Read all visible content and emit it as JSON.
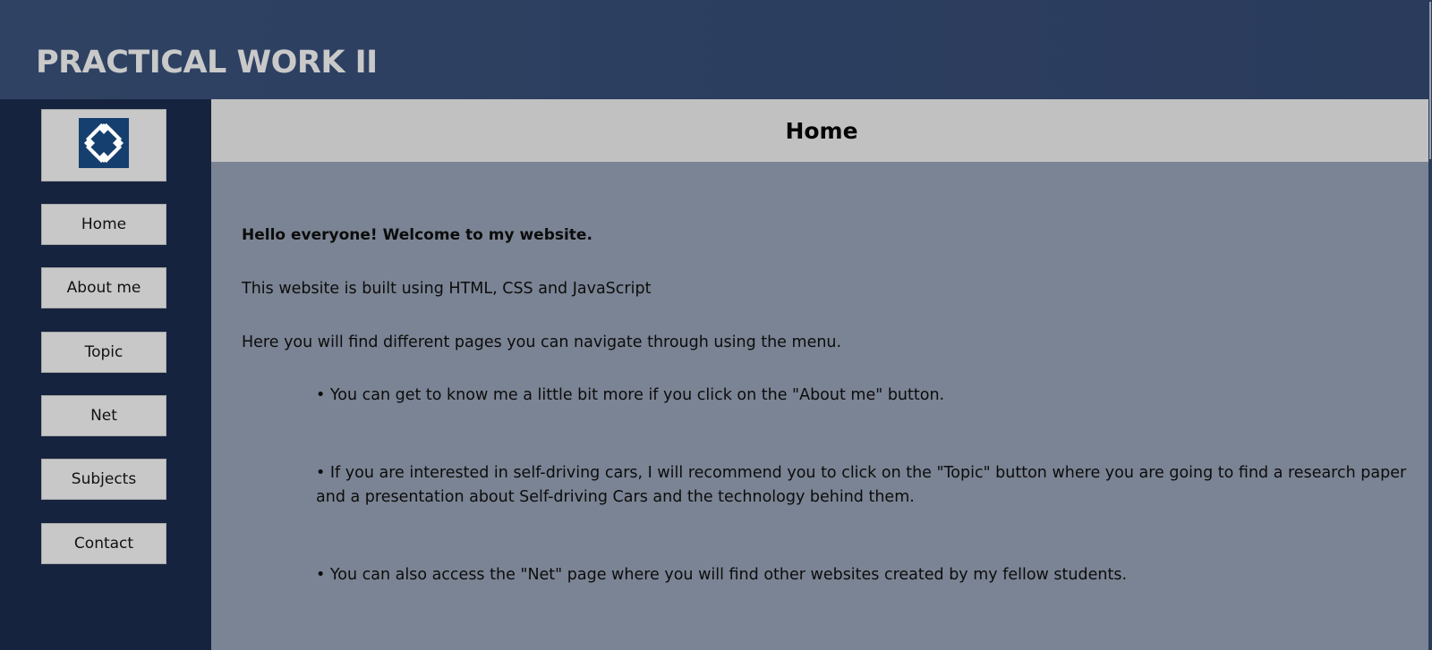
{
  "header": {
    "title": "PRACTICAL WORK II"
  },
  "sidebar": {
    "logo_icon": "logo-icon",
    "items": [
      {
        "label": "Home"
      },
      {
        "label": "About me"
      },
      {
        "label": "Topic"
      },
      {
        "label": "Net"
      },
      {
        "label": "Subjects"
      },
      {
        "label": "Contact"
      }
    ]
  },
  "main": {
    "page_title": "Home",
    "welcome": "Hello everyone! Welcome to my website.",
    "built_with": "This website is built using HTML, CSS and JavaScript",
    "navigate": "Here you will find different pages you can navigate through using the menu.",
    "bullets": [
      "• You can get to know me a little bit more if you click on the \"About me\" button.",
      "• If you are interested in self-driving cars, I will recommend you to click on the \"Topic\" button where you are going to find a research paper and a presentation about Self-driving Cars and the technology behind them.",
      "• You can also access the \"Net\" page where you will find other websites created by my fellow students."
    ]
  },
  "colors": {
    "header_bg": "#2c3e5f",
    "sidebar_bg": "#16233f",
    "main_bg": "#7b8494",
    "title_bar_bg": "#c1c1c1",
    "button_bg": "#c8c8c8",
    "logo_bg": "#153f6e"
  }
}
